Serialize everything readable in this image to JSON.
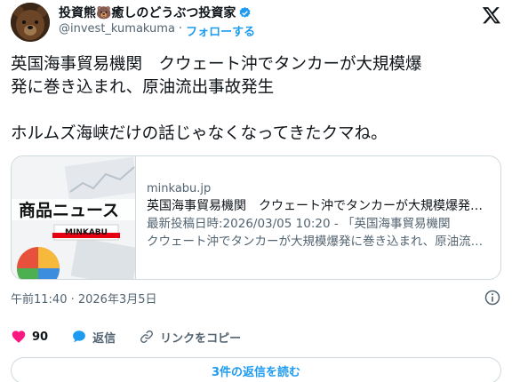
{
  "author": {
    "display_name": "投資熊🐻癒しのどうぶつ投資家",
    "handle": "@invest_kumakuma",
    "separator": "·",
    "follow_label": "フォローする"
  },
  "tweet": {
    "line1": "英国海事貿易機関　クウェート沖でタンカーが大規模爆",
    "line2": "発に巻き込まれ、原油流出事故発生",
    "line3": "ホルムズ海峡だけの話じゃなくなってきたクマね。"
  },
  "card": {
    "thumb_title": "商品ニュース",
    "thumb_brand": "MINKABU",
    "domain": "minkabu.jp",
    "title": "英国海事貿易機関　クウェート沖でタンカーが大規模爆発に巻き込まれ、原油流出事故発生",
    "desc_line1": "最新投稿日時:2026/03/05 10:20 - 「英国海事貿易機関",
    "desc_line2": "クウェート沖でタンカーが大規模爆発に巻き込まれ、原油流出事故発生"
  },
  "timestamp": "午前11:40 · 2026年3月5日",
  "actions": {
    "like_count": "90",
    "reply_label": "返信",
    "copy_link_label": "リンクをコピー"
  },
  "read_replies_label": "3件の返信を読む",
  "colors": {
    "accent": "#1d9bf0",
    "like": "#f91880",
    "muted": "#536471",
    "border": "#cfd9de"
  }
}
